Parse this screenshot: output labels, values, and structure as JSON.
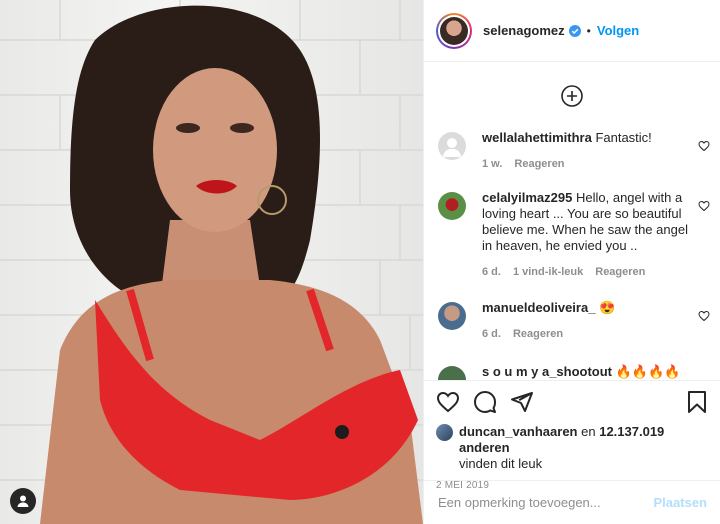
{
  "header": {
    "username": "selenagomez",
    "dot": "•",
    "follow_label": "Volgen"
  },
  "comments": [
    {
      "username": "wellalahettimithra",
      "text": "Fantastic!",
      "time": "1 w.",
      "likes": "",
      "reply_label": "Reageren",
      "avatar_color": "#dbdbdb"
    },
    {
      "username": "celalyilmaz295",
      "text": "Hello, angel with a loving heart ... You are so beautiful believe me. When he saw the angel in heaven, he envied you ..",
      "time": "6 d.",
      "likes": "1 vind-ik-leuk",
      "reply_label": "Reageren",
      "avatar_color": "#5a8f46"
    },
    {
      "username": "manueldeoliveira_",
      "text": "😍",
      "time": "6 d.",
      "likes": "",
      "reply_label": "Reageren",
      "avatar_color": "#8a7766"
    },
    {
      "username": "s o u m y a_shootout",
      "text": "🔥🔥🔥🔥",
      "time": "",
      "likes": "",
      "reply_label": "",
      "avatar_color": "#4b6f4b"
    }
  ],
  "likes": {
    "first_user": "duncan_vanhaaren",
    "connector": "en",
    "others": "12.137.019 anderen",
    "suffix": "vinden dit leuk"
  },
  "date": "2 MEI 2019",
  "add_comment": {
    "placeholder": "Een opmerking toevoegen...",
    "post_label": "Plaatsen"
  },
  "colors": {
    "accent": "#0095f6",
    "post_disabled": "#b2dffc",
    "muted": "#8e8e8e"
  }
}
